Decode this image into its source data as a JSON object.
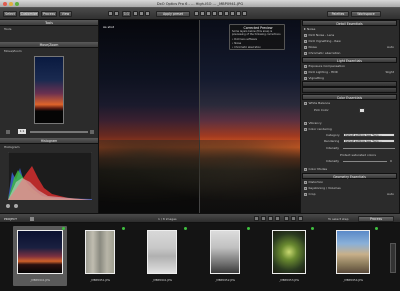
{
  "window": {
    "title": "DxO Optics Pro 6 - … High-ISO … _MBP0941.JPG"
  },
  "toolbar": {
    "tabs": [
      "Select",
      "Customize",
      "Process",
      "View"
    ],
    "apply_preset": "Apply preset",
    "zoom": "1:1",
    "palettes": "Palettes",
    "workspace": "Workspace"
  },
  "left": {
    "tools_title": "Tools",
    "tools_sub": "Tools",
    "move_zoom_title": "Move/Zoom",
    "move_zoom_sub": "Move/Zoom",
    "zoom_value": "1:1",
    "histogram_title": "Histogram",
    "histogram_sub": "Histogram"
  },
  "viewer": {
    "as_shot": "As shot",
    "preview_title": "Corrected Preview",
    "preview_text": "Some layers below (this area) is previewing of the following corrections",
    "bullets": [
      "• DxO lens software",
      "• Noise",
      "• Chromatic aberration"
    ]
  },
  "right": {
    "detail_title": "Detail Essentials",
    "noise": "Noise",
    "dxo_noise": "DxO Noise - Lens",
    "dxo_vignetting": "DxO Vignetting - Raw",
    "noise_item": "Noise",
    "auto": "Auto",
    "chromatic": "Chromatic aberration",
    "light_title": "Light Essentials",
    "exposure": "Exposure Compensation",
    "lighting": "DxO Lighting - HDR",
    "lighting_value": "Slight",
    "vignetting": "Vignetting",
    "color_title": "Color Essentials",
    "white_balance": "White Balance",
    "pick_color": "Pick Color",
    "vibrancy": "Vibrancy",
    "color_rendering": "Color rendering",
    "category_label": "Category",
    "category_value": "Default settings (see \"Sure …",
    "rendering_label": "Rendering",
    "rendering_value": "Default settings (see \"Sure …",
    "intensity_label": "Intensity",
    "protect_label": "Protect saturated colors",
    "intensity2_label": "Intensity",
    "intensity2_value": "0",
    "color_modes": "Color Modes",
    "geometry_title": "Geometry Essentials",
    "distortion": "Distortion",
    "keystoning": "Keystoning / Volumes",
    "crop": "Crop",
    "crop_value": "Auto"
  },
  "project_bar": {
    "project": "PROJECT",
    "images": "1 / 8 images",
    "to_process": "To select step",
    "process": "Process"
  },
  "filmstrip": [
    {
      "label": "_MBP0941.JPG",
      "selected": true
    },
    {
      "label": "_MBP0951.JPG",
      "selected": false
    },
    {
      "label": "_MBP0941.JPG",
      "selected": false
    },
    {
      "label": "_MBP0952.JPG",
      "selected": false
    },
    {
      "label": "_MBP0953.JPG",
      "selected": false
    },
    {
      "label": "_MBP0954.JPG",
      "selected": false
    }
  ]
}
